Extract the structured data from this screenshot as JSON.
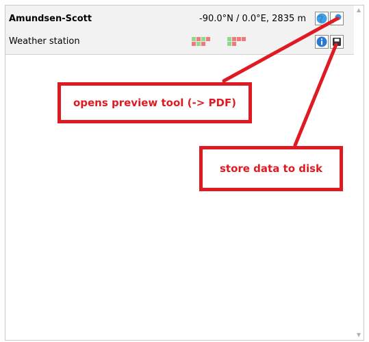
{
  "station": {
    "name": "Amundsen-Scott",
    "type": "Weather station",
    "coordinates": "-90.0°N / 0.0°E, 2835 m",
    "buttons": [
      {
        "name": "globe-button",
        "icon": "globe-icon"
      },
      {
        "name": "preview-button",
        "icon": "magnifier-icon"
      },
      {
        "name": "info-button",
        "icon": "info-icon"
      },
      {
        "name": "store-button",
        "icon": "save-disk-icon"
      }
    ],
    "quality_colors": {
      "good": "#8fd98f",
      "bad": "#f07a7a"
    }
  },
  "annotations": {
    "preview": "opens preview tool (-> PDF)",
    "store": "store data to disk",
    "color": "#e01a22"
  }
}
